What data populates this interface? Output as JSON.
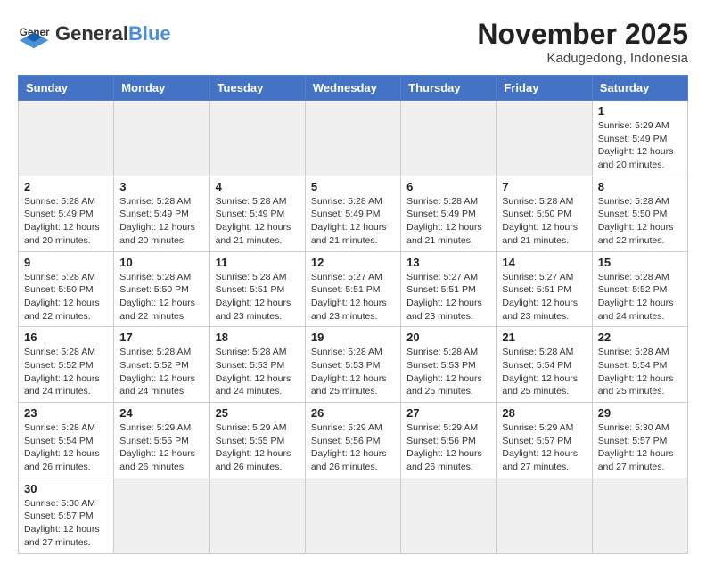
{
  "logo": {
    "text_general": "General",
    "text_blue": "Blue"
  },
  "title": "November 2025",
  "location": "Kadugedong, Indonesia",
  "days_of_week": [
    "Sunday",
    "Monday",
    "Tuesday",
    "Wednesday",
    "Thursday",
    "Friday",
    "Saturday"
  ],
  "weeks": [
    [
      {
        "day": "",
        "empty": true
      },
      {
        "day": "",
        "empty": true
      },
      {
        "day": "",
        "empty": true
      },
      {
        "day": "",
        "empty": true
      },
      {
        "day": "",
        "empty": true
      },
      {
        "day": "",
        "empty": true
      },
      {
        "day": "1",
        "info": "Sunrise: 5:29 AM\nSunset: 5:49 PM\nDaylight: 12 hours\nand 20 minutes."
      }
    ],
    [
      {
        "day": "2",
        "info": "Sunrise: 5:28 AM\nSunset: 5:49 PM\nDaylight: 12 hours\nand 20 minutes."
      },
      {
        "day": "3",
        "info": "Sunrise: 5:28 AM\nSunset: 5:49 PM\nDaylight: 12 hours\nand 20 minutes."
      },
      {
        "day": "4",
        "info": "Sunrise: 5:28 AM\nSunset: 5:49 PM\nDaylight: 12 hours\nand 21 minutes."
      },
      {
        "day": "5",
        "info": "Sunrise: 5:28 AM\nSunset: 5:49 PM\nDaylight: 12 hours\nand 21 minutes."
      },
      {
        "day": "6",
        "info": "Sunrise: 5:28 AM\nSunset: 5:49 PM\nDaylight: 12 hours\nand 21 minutes."
      },
      {
        "day": "7",
        "info": "Sunrise: 5:28 AM\nSunset: 5:50 PM\nDaylight: 12 hours\nand 21 minutes."
      },
      {
        "day": "8",
        "info": "Sunrise: 5:28 AM\nSunset: 5:50 PM\nDaylight: 12 hours\nand 22 minutes."
      }
    ],
    [
      {
        "day": "9",
        "info": "Sunrise: 5:28 AM\nSunset: 5:50 PM\nDaylight: 12 hours\nand 22 minutes."
      },
      {
        "day": "10",
        "info": "Sunrise: 5:28 AM\nSunset: 5:50 PM\nDaylight: 12 hours\nand 22 minutes."
      },
      {
        "day": "11",
        "info": "Sunrise: 5:28 AM\nSunset: 5:51 PM\nDaylight: 12 hours\nand 23 minutes."
      },
      {
        "day": "12",
        "info": "Sunrise: 5:27 AM\nSunset: 5:51 PM\nDaylight: 12 hours\nand 23 minutes."
      },
      {
        "day": "13",
        "info": "Sunrise: 5:27 AM\nSunset: 5:51 PM\nDaylight: 12 hours\nand 23 minutes."
      },
      {
        "day": "14",
        "info": "Sunrise: 5:27 AM\nSunset: 5:51 PM\nDaylight: 12 hours\nand 23 minutes."
      },
      {
        "day": "15",
        "info": "Sunrise: 5:28 AM\nSunset: 5:52 PM\nDaylight: 12 hours\nand 24 minutes."
      }
    ],
    [
      {
        "day": "16",
        "info": "Sunrise: 5:28 AM\nSunset: 5:52 PM\nDaylight: 12 hours\nand 24 minutes."
      },
      {
        "day": "17",
        "info": "Sunrise: 5:28 AM\nSunset: 5:52 PM\nDaylight: 12 hours\nand 24 minutes."
      },
      {
        "day": "18",
        "info": "Sunrise: 5:28 AM\nSunset: 5:53 PM\nDaylight: 12 hours\nand 24 minutes."
      },
      {
        "day": "19",
        "info": "Sunrise: 5:28 AM\nSunset: 5:53 PM\nDaylight: 12 hours\nand 25 minutes."
      },
      {
        "day": "20",
        "info": "Sunrise: 5:28 AM\nSunset: 5:53 PM\nDaylight: 12 hours\nand 25 minutes."
      },
      {
        "day": "21",
        "info": "Sunrise: 5:28 AM\nSunset: 5:54 PM\nDaylight: 12 hours\nand 25 minutes."
      },
      {
        "day": "22",
        "info": "Sunrise: 5:28 AM\nSunset: 5:54 PM\nDaylight: 12 hours\nand 25 minutes."
      }
    ],
    [
      {
        "day": "23",
        "info": "Sunrise: 5:28 AM\nSunset: 5:54 PM\nDaylight: 12 hours\nand 26 minutes."
      },
      {
        "day": "24",
        "info": "Sunrise: 5:29 AM\nSunset: 5:55 PM\nDaylight: 12 hours\nand 26 minutes."
      },
      {
        "day": "25",
        "info": "Sunrise: 5:29 AM\nSunset: 5:55 PM\nDaylight: 12 hours\nand 26 minutes."
      },
      {
        "day": "26",
        "info": "Sunrise: 5:29 AM\nSunset: 5:56 PM\nDaylight: 12 hours\nand 26 minutes."
      },
      {
        "day": "27",
        "info": "Sunrise: 5:29 AM\nSunset: 5:56 PM\nDaylight: 12 hours\nand 26 minutes."
      },
      {
        "day": "28",
        "info": "Sunrise: 5:29 AM\nSunset: 5:57 PM\nDaylight: 12 hours\nand 27 minutes."
      },
      {
        "day": "29",
        "info": "Sunrise: 5:30 AM\nSunset: 5:57 PM\nDaylight: 12 hours\nand 27 minutes."
      }
    ],
    [
      {
        "day": "30",
        "info": "Sunrise: 5:30 AM\nSunset: 5:57 PM\nDaylight: 12 hours\nand 27 minutes."
      },
      {
        "day": "",
        "empty": true
      },
      {
        "day": "",
        "empty": true
      },
      {
        "day": "",
        "empty": true
      },
      {
        "day": "",
        "empty": true
      },
      {
        "day": "",
        "empty": true
      },
      {
        "day": "",
        "empty": true
      }
    ]
  ]
}
